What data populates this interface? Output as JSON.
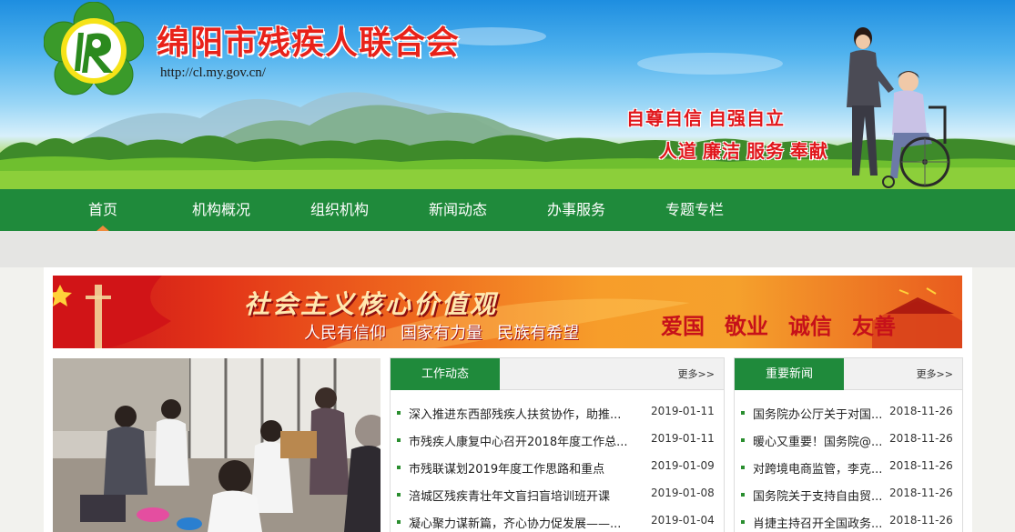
{
  "header": {
    "site_title": "绵阳市残疾人联合会",
    "site_url": "http://cl.my.gov.cn/",
    "slogan_line1": "自尊自信 自强自立",
    "slogan_line2": "人道 廉洁 服务 奉献",
    "logo_icon": "disability-federation-flower-logo"
  },
  "nav": {
    "items": [
      "首页",
      "机构概况",
      "组织机构",
      "新闻动态",
      "办事服务",
      "专题专栏"
    ],
    "active_index": 0
  },
  "values_banner": {
    "title": "社会主义核心价值观",
    "sub_1": "人民有信仰",
    "sub_2": "国家有力量",
    "sub_3": "民族有希望",
    "words": [
      "爱国",
      "敬业",
      "诚信",
      "友善"
    ]
  },
  "work_news": {
    "tab": "工作动态",
    "more": "更多>>",
    "rows": [
      {
        "title": "深入推进东西部残疾人扶贫协作，助推...",
        "date": "2019-01-11"
      },
      {
        "title": "市残疾人康复中心召开2018年度工作总...",
        "date": "2019-01-11"
      },
      {
        "title": "市残联谋划2019年度工作思路和重点",
        "date": "2019-01-09"
      },
      {
        "title": "涪城区残疾青壮年文盲扫盲培训班开课",
        "date": "2019-01-08"
      },
      {
        "title": "凝心聚力谋新篇，齐心协力促发展——...",
        "date": "2019-01-04"
      }
    ]
  },
  "important_news": {
    "tab": "重要新闻",
    "more": "更多>>",
    "rows": [
      {
        "title": "国务院办公厅关于对国...",
        "date": "2018-11-26"
      },
      {
        "title": "暖心又重要！国务院@...",
        "date": "2018-11-26"
      },
      {
        "title": "对跨境电商监管，李克...",
        "date": "2018-11-26"
      },
      {
        "title": "国务院关于支持自由贸...",
        "date": "2018-11-26"
      },
      {
        "title": "肖捷主持召开全国政务...",
        "date": "2018-11-26"
      }
    ]
  },
  "colors": {
    "nav_green": "#1f8a3b",
    "title_red": "#e8221a",
    "caret_orange": "#f08a3c"
  }
}
